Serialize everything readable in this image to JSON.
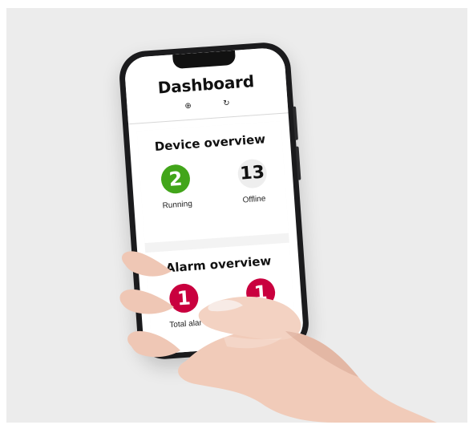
{
  "screen": {
    "title": "Dashboard",
    "header_icons": [
      {
        "name": "add-circle-icon",
        "glyph": "⊕"
      },
      {
        "name": "refresh-icon",
        "glyph": "↻"
      }
    ]
  },
  "device_overview": {
    "title": "Device overview",
    "items": [
      {
        "value": "2",
        "label": "Running",
        "color": "#42a51a"
      },
      {
        "value": "13",
        "label": "Offline",
        "color": "#eeeeee"
      }
    ]
  },
  "alarm_overview": {
    "title": "Alarm overview",
    "items": [
      {
        "value": "1",
        "label": "Total alar",
        "color": "#c9003e"
      },
      {
        "value": "1",
        "label": "",
        "color": "#c9003e"
      }
    ]
  }
}
